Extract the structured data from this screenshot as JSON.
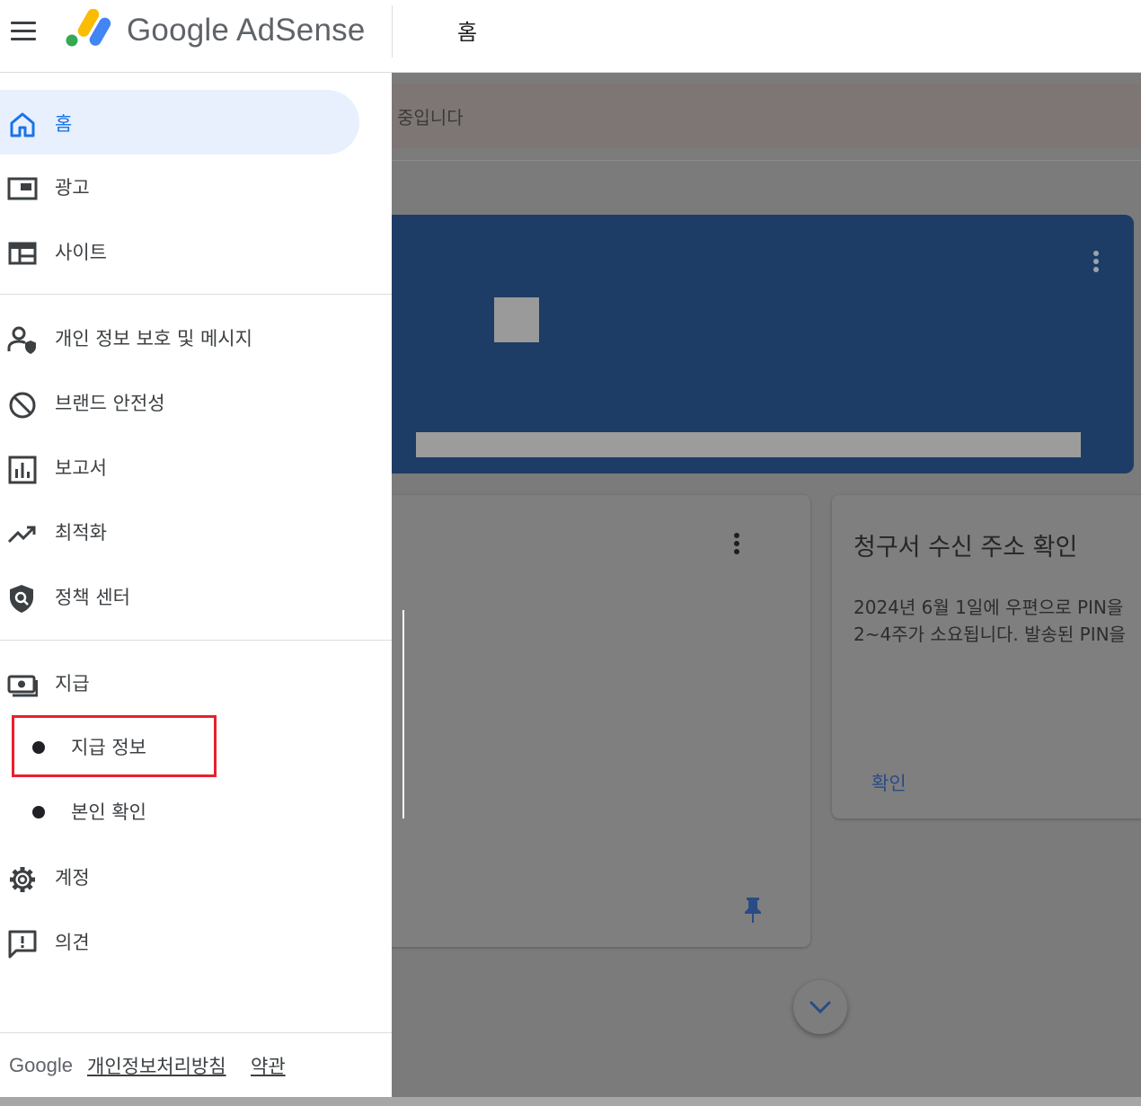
{
  "app": {
    "brand_text": "Google AdSense",
    "page_title": "홈"
  },
  "banner": {
    "text": "중입니다"
  },
  "sidebar": {
    "items": [
      {
        "label": "홈",
        "icon": "home-icon",
        "active": true
      },
      {
        "label": "광고",
        "icon": "ads-icon"
      },
      {
        "label": "사이트",
        "icon": "sites-icon"
      },
      {
        "label": "개인 정보 보호 및 메시지",
        "icon": "privacy-icon"
      },
      {
        "label": "브랜드 안전성",
        "icon": "block-icon"
      },
      {
        "label": "보고서",
        "icon": "reports-icon"
      },
      {
        "label": "최적화",
        "icon": "trending-icon"
      },
      {
        "label": "정책 센터",
        "icon": "policy-shield-icon"
      },
      {
        "label": "지급",
        "icon": "payments-icon"
      },
      {
        "label": "계정",
        "icon": "gear-icon"
      },
      {
        "label": "의견",
        "icon": "feedback-icon"
      }
    ],
    "payments_sub": [
      {
        "label": "지급 정보"
      },
      {
        "label": "본인 확인"
      }
    ],
    "footer": {
      "brand": "Google",
      "privacy": "개인정보처리방침",
      "terms": "약관"
    }
  },
  "cards": {
    "address": {
      "title": "청구서 수신 주소 확인",
      "body_line1": "2024년 6월 1일에 우편으로 PIN을",
      "body_line2": "2~4주가 소요됩니다. 발송된 PIN을",
      "link": "확인"
    }
  },
  "colors": {
    "accent": "#1a73e8",
    "active_bg": "#e8f0fe",
    "highlight": "#e8202d",
    "overlay": "#7b7b7b"
  }
}
